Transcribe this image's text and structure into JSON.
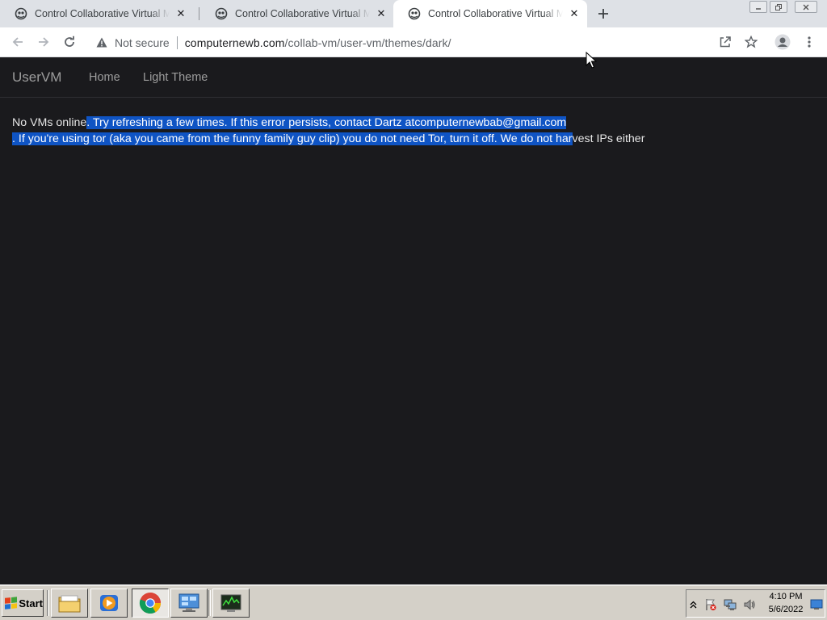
{
  "browser": {
    "tabs": [
      {
        "title": "Control Collaborative Virtual Machines",
        "active": false
      },
      {
        "title": "Control Collaborative Virtual Machines",
        "active": false
      },
      {
        "title": "Control Collaborative Virtual Machines",
        "active": true
      }
    ],
    "new_tab_icon": "plus-icon",
    "security_label": "Not secure",
    "url_host": "computernewb.com",
    "url_path": "/collab-vm/user-vm/themes/dark/"
  },
  "page": {
    "brand": "UserVM",
    "nav": [
      "Home",
      "Light Theme"
    ],
    "message_line1_plain": "No VMs online",
    "message_line1_selected": ". Try refreshing a few times. If this error persists, contact Dartz atcomputernewbab@gmail.com",
    "message_line2_selected": ". If you're using tor (aka you came from the funny family guy clip) you do not need Tor, turn it off. We do not har",
    "message_line2_plain": "vest IPs either"
  },
  "taskbar": {
    "start_label": "Start",
    "apps": [
      "file-explorer-icon",
      "media-player-icon",
      "chrome-icon",
      "control-panel-icon",
      "task-manager-icon"
    ],
    "clock_time": "4:10 PM",
    "clock_date": "5/6/2022"
  },
  "colors": {
    "page_bg": "#1a1a1d",
    "selection": "#0f54c4",
    "nav_text": "#9d9d9d"
  }
}
